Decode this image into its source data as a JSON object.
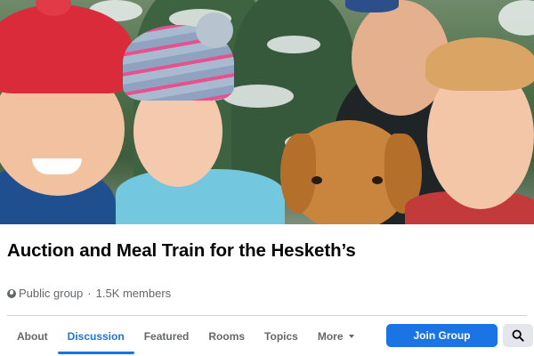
{
  "group": {
    "name": "Auction and Meal Train for the Hesketh’s",
    "privacy": "Public group",
    "separator": "·",
    "members": "1.5K members"
  },
  "cover_photo": {
    "subject": "family-selfie-with-dog"
  },
  "tabs": [
    {
      "label": "About",
      "active": false
    },
    {
      "label": "Discussion",
      "active": true
    },
    {
      "label": "Featured",
      "active": false
    },
    {
      "label": "Rooms",
      "active": false
    },
    {
      "label": "Topics",
      "active": false
    },
    {
      "label": "More",
      "active": false,
      "has_dropdown": true
    }
  ],
  "actions": {
    "join_label": "Join Group",
    "search_icon": "magnifier-icon"
  },
  "colors": {
    "accent": "#1b74e4",
    "text_primary": "#050505",
    "text_secondary": "#65676b",
    "button_secondary_bg": "#e4e6eb"
  }
}
